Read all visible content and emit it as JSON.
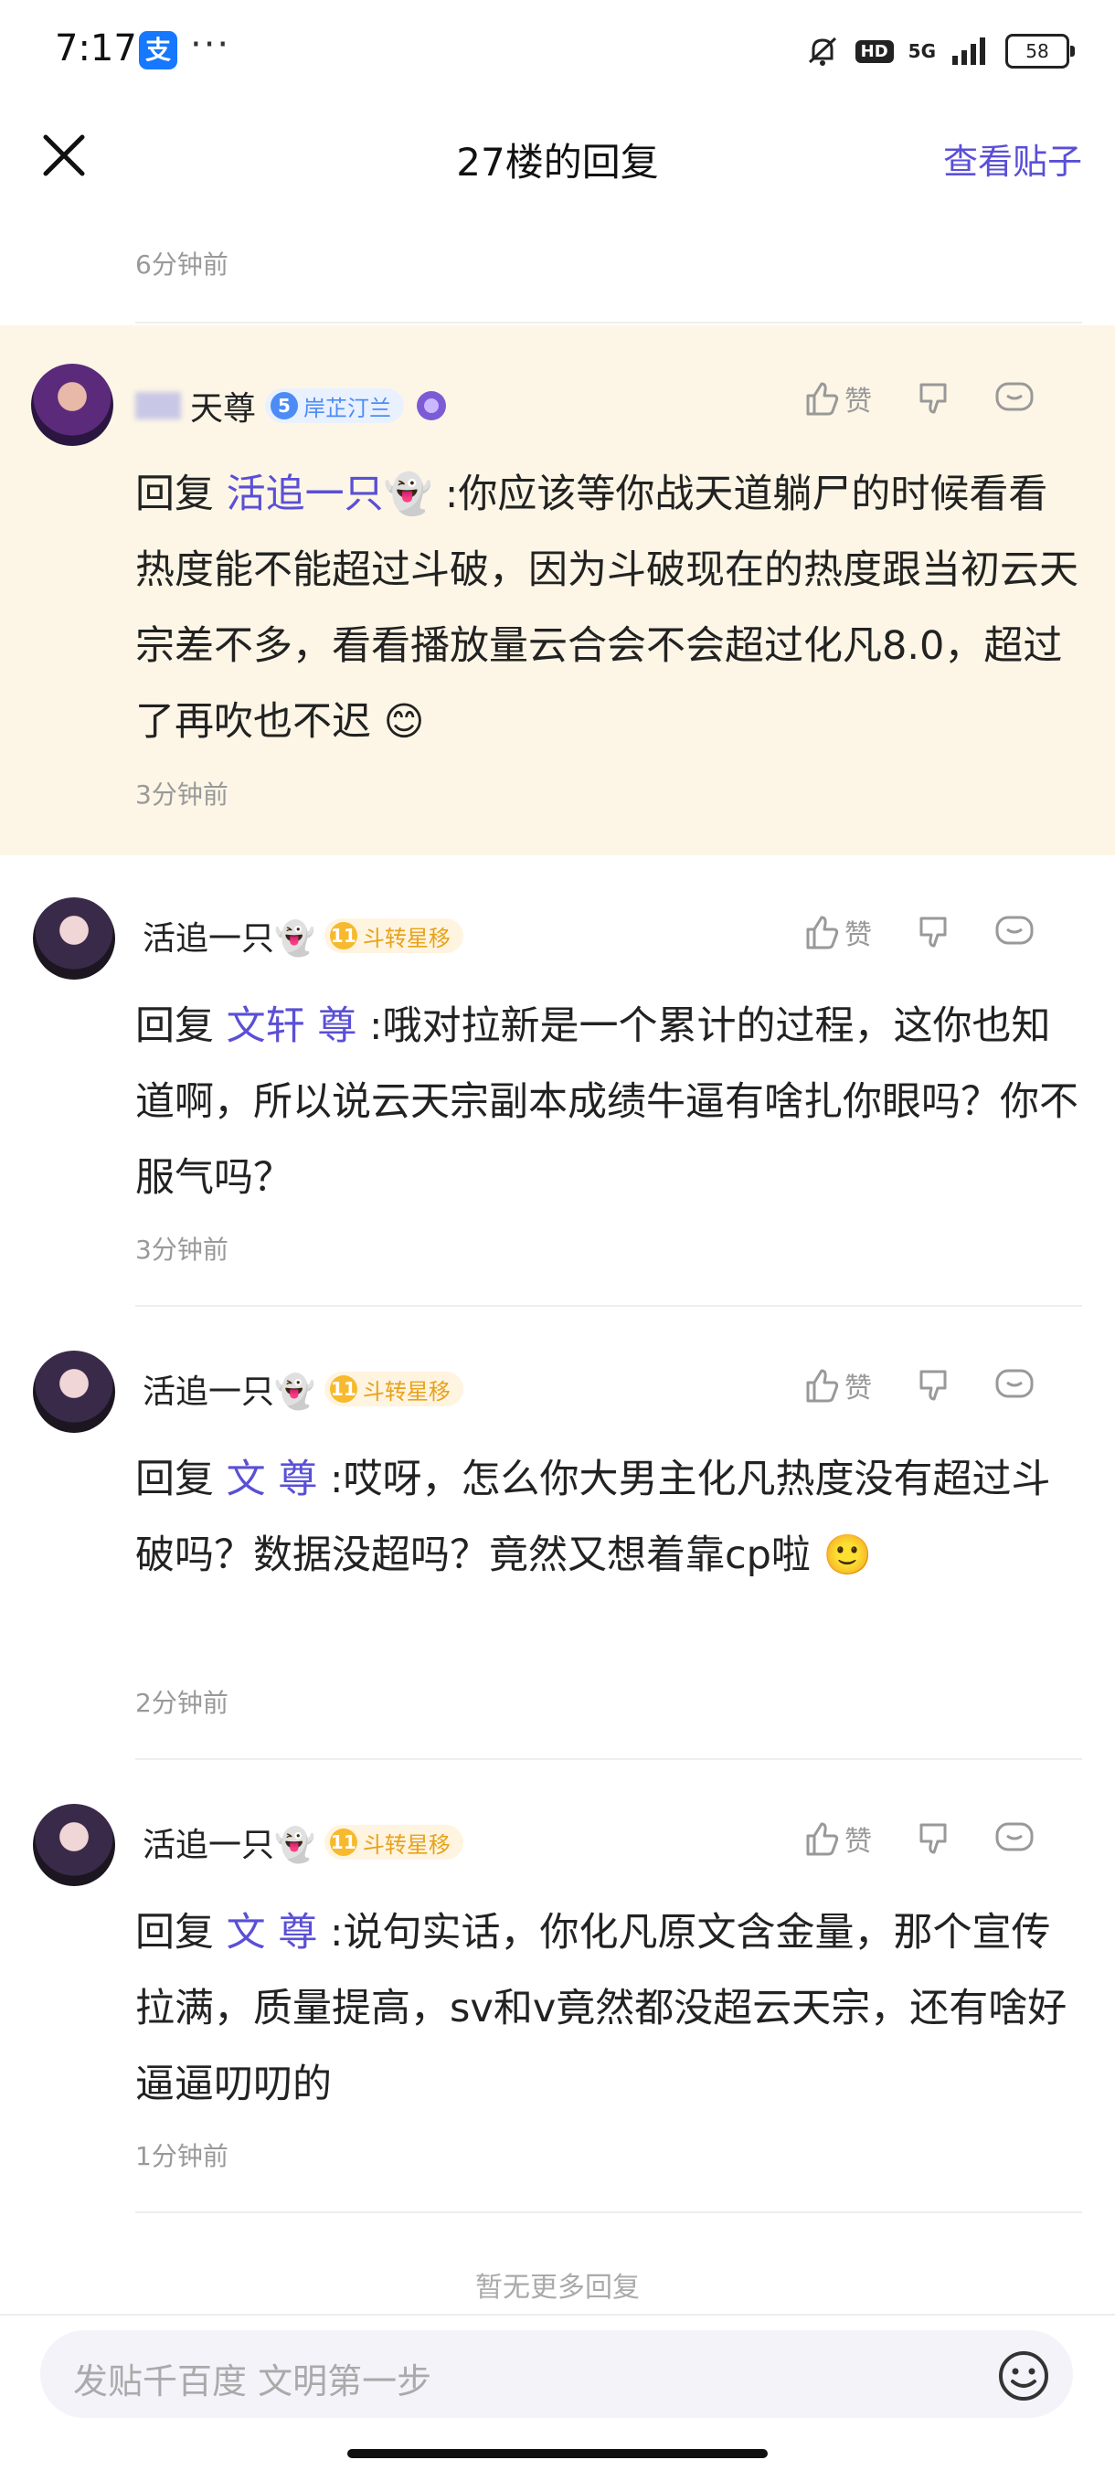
{
  "status_bar": {
    "time": "7:17",
    "alipay_icon": "支",
    "more": "···",
    "hd": "HD",
    "network": "5G",
    "battery": "58"
  },
  "nav": {
    "title": "27楼的回复",
    "view_post": "查看贴子"
  },
  "prev_time": "6分钟前",
  "replies": [
    {
      "user": "天尊",
      "badge_level": "5",
      "badge_text": "岸芷汀兰",
      "like_label": "赞",
      "reply_prefix": "回复",
      "reply_to": "活追一只👻",
      "text": ":你应该等你战天道躺尸的时候看看热度能不能超过斗破，因为斗破现在的热度跟当初云天宗差不多，看看播放量云合会不会超过化凡8.0，超过了再吹也不迟 😊",
      "time": "3分钟前"
    },
    {
      "user": "活追一只👻",
      "badge_level": "11",
      "badge_text": "斗转星移",
      "like_label": "赞",
      "reply_prefix": "回复",
      "reply_to": "文轩 尊",
      "text": ":哦对拉新是一个累计的过程，这你也知道啊，所以说云天宗副本成绩牛逼有啥扎你眼吗？你不服气吗？",
      "time": "3分钟前"
    },
    {
      "user": "活追一只👻",
      "badge_level": "11",
      "badge_text": "斗转星移",
      "like_label": "赞",
      "reply_prefix": "回复",
      "reply_to": "文 尊",
      "text": ":哎呀，怎么你大男主化凡热度没有超过斗破吗？数据没超吗？竟然又想着靠cp啦 🙂",
      "time": "2分钟前"
    },
    {
      "user": "活追一只👻",
      "badge_level": "11",
      "badge_text": "斗转星移",
      "like_label": "赞",
      "reply_prefix": "回复",
      "reply_to": "文 尊",
      "text": ":说句实话，你化凡原文含金量，那个宣传拉满，质量提高，sv和v竟然都没超云天宗，还有啥好逼逼叨叨的",
      "time": "1分钟前"
    }
  ],
  "no_more": "暂无更多回复",
  "input_placeholder": "发贴千百度 文明第一步",
  "colors": {
    "accent": "#5a4fd6",
    "highlight_bg": "#fdf6e6",
    "gold_badge": "#f7b92e",
    "blue_badge": "#4d8cf5"
  }
}
